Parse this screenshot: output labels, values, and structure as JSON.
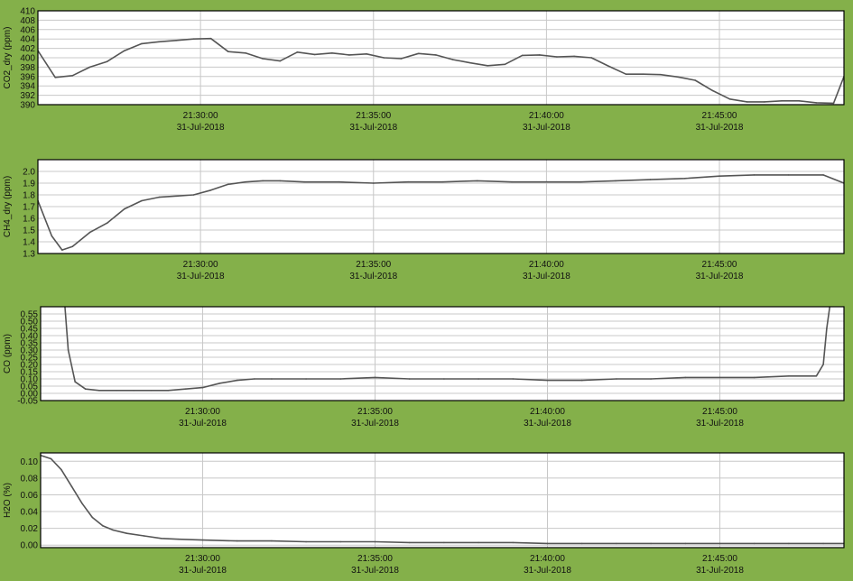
{
  "window": {
    "background": "#84b04a",
    "plot_background": "#ffffff",
    "grid_color": "#c8c8c8",
    "line_color": "#555555"
  },
  "chart_data": [
    {
      "type": "line",
      "ylabel": "CO2_dry (ppm)",
      "ylim": [
        390,
        410
      ],
      "yticks": [
        "410",
        "408",
        "406",
        "404",
        "402",
        "400",
        "398",
        "396",
        "394",
        "392",
        "390"
      ],
      "xlim_minutes": [
        25.3,
        48.6
      ],
      "xticks": [
        {
          "time": "21:30:00",
          "date": "31-Jul-2018",
          "minute": 30
        },
        {
          "time": "21:35:00",
          "date": "31-Jul-2018",
          "minute": 35
        },
        {
          "time": "21:40:00",
          "date": "31-Jul-2018",
          "minute": 40
        },
        {
          "time": "21:45:00",
          "date": "31-Jul-2018",
          "minute": 45
        }
      ],
      "grid": true,
      "series": [
        {
          "x": [
            "21:25:18",
            "21:25:48",
            "21:26:18",
            "21:26:48",
            "21:27:18",
            "21:27:48",
            "21:28:18",
            "21:28:48",
            "21:29:18",
            "21:29:48",
            "21:30:18",
            "21:30:48",
            "21:31:18",
            "21:31:48",
            "21:32:18",
            "21:32:48",
            "21:33:18",
            "21:33:48",
            "21:34:18",
            "21:34:48",
            "21:35:18",
            "21:35:48",
            "21:36:18",
            "21:36:48",
            "21:37:18",
            "21:37:48",
            "21:38:18",
            "21:38:48",
            "21:39:18",
            "21:39:48",
            "21:40:18",
            "21:40:48",
            "21:41:18",
            "21:41:48",
            "21:42:18",
            "21:42:48",
            "21:43:18",
            "21:43:48",
            "21:44:18",
            "21:44:48",
            "21:45:18",
            "21:45:48",
            "21:46:18",
            "21:46:48",
            "21:47:18",
            "21:47:48",
            "21:48:18",
            "21:48:36"
          ],
          "values": [
            401.5,
            395.8,
            396.2,
            398.0,
            399.2,
            401.5,
            403.0,
            403.4,
            403.7,
            404.0,
            404.1,
            401.3,
            401.0,
            399.8,
            399.3,
            401.2,
            400.7,
            401.0,
            400.6,
            400.8,
            400.0,
            399.8,
            400.9,
            400.6,
            399.6,
            398.9,
            398.3,
            398.6,
            400.5,
            400.6,
            400.2,
            400.3,
            400.0,
            398.2,
            396.5,
            396.5,
            396.4,
            395.9,
            395.2,
            393.0,
            391.2,
            390.6,
            390.6,
            390.8,
            390.8,
            390.4,
            390.3,
            396.0
          ]
        }
      ]
    },
    {
      "type": "line",
      "ylabel": "CH4_dry (ppm)",
      "ylim": [
        1.3,
        2.1
      ],
      "yticks": [
        "2.0",
        "1.9",
        "1.8",
        "1.7",
        "1.6",
        "1.5",
        "1.4",
        "1.3"
      ],
      "xlim_minutes": [
        25.3,
        48.6
      ],
      "xticks": [
        {
          "time": "21:30:00",
          "date": "31-Jul-2018",
          "minute": 30
        },
        {
          "time": "21:35:00",
          "date": "31-Jul-2018",
          "minute": 35
        },
        {
          "time": "21:40:00",
          "date": "31-Jul-2018",
          "minute": 40
        },
        {
          "time": "21:45:00",
          "date": "31-Jul-2018",
          "minute": 45
        }
      ],
      "grid": true,
      "series": [
        {
          "x": [
            "21:25:18",
            "21:25:42",
            "21:26:00",
            "21:26:18",
            "21:26:48",
            "21:27:18",
            "21:27:48",
            "21:28:18",
            "21:28:48",
            "21:29:18",
            "21:29:48",
            "21:30:18",
            "21:30:48",
            "21:31:18",
            "21:31:48",
            "21:32:18",
            "21:33:00",
            "21:34:00",
            "21:35:00",
            "21:36:00",
            "21:37:00",
            "21:38:00",
            "21:39:00",
            "21:40:00",
            "21:41:00",
            "21:42:00",
            "21:43:00",
            "21:44:00",
            "21:45:00",
            "21:46:00",
            "21:47:00",
            "21:48:00",
            "21:48:36"
          ],
          "values": [
            1.75,
            1.45,
            1.33,
            1.36,
            1.48,
            1.56,
            1.68,
            1.75,
            1.78,
            1.79,
            1.8,
            1.84,
            1.89,
            1.91,
            1.92,
            1.92,
            1.91,
            1.91,
            1.9,
            1.91,
            1.91,
            1.92,
            1.91,
            1.91,
            1.91,
            1.92,
            1.93,
            1.94,
            1.96,
            1.97,
            1.97,
            1.97,
            1.9
          ]
        }
      ]
    },
    {
      "type": "line",
      "ylabel": "CO (ppm)",
      "ylim": [
        -0.05,
        0.6
      ],
      "yticks": [
        "0.55",
        "0.50",
        "0.45",
        "0.40",
        "0.35",
        "0.30",
        "0.25",
        "0.20",
        "0.15",
        "0.10",
        "0.05",
        "0.00",
        "-0.05"
      ],
      "xlim_minutes": [
        25.3,
        48.6
      ],
      "xticks": [
        {
          "time": "21:30:00",
          "date": "31-Jul-2018",
          "minute": 30
        },
        {
          "time": "21:35:00",
          "date": "31-Jul-2018",
          "minute": 35
        },
        {
          "time": "21:40:00",
          "date": "31-Jul-2018",
          "minute": 40
        },
        {
          "time": "21:45:00",
          "date": "31-Jul-2018",
          "minute": 45
        }
      ],
      "grid": true,
      "series": [
        {
          "x": [
            "21:26:00",
            "21:26:06",
            "21:26:18",
            "21:26:36",
            "21:27:00",
            "21:27:30",
            "21:28:00",
            "21:28:30",
            "21:29:00",
            "21:29:30",
            "21:30:00",
            "21:30:30",
            "21:31:00",
            "21:31:30",
            "21:32:00",
            "21:33:00",
            "21:34:00",
            "21:35:00",
            "21:36:00",
            "21:37:00",
            "21:38:00",
            "21:39:00",
            "21:40:00",
            "21:41:00",
            "21:42:00",
            "21:43:00",
            "21:44:00",
            "21:45:00",
            "21:46:00",
            "21:47:00",
            "21:47:48",
            "21:48:00",
            "21:48:06",
            "21:48:12"
          ],
          "values": [
            0.62,
            0.3,
            0.08,
            0.03,
            0.02,
            0.02,
            0.02,
            0.02,
            0.02,
            0.03,
            0.04,
            0.07,
            0.09,
            0.1,
            0.1,
            0.1,
            0.1,
            0.11,
            0.1,
            0.1,
            0.1,
            0.1,
            0.09,
            0.09,
            0.1,
            0.1,
            0.11,
            0.11,
            0.11,
            0.12,
            0.12,
            0.2,
            0.45,
            0.62
          ]
        }
      ]
    },
    {
      "type": "line",
      "ylabel": "H2O (%)",
      "ylim": [
        -0.003,
        0.11
      ],
      "yticks": [
        "0.10",
        "0.08",
        "0.06",
        "0.04",
        "0.02",
        "0.00"
      ],
      "xlim_minutes": [
        25.3,
        48.6
      ],
      "xticks": [
        {
          "time": "21:30:00",
          "date": "31-Jul-2018",
          "minute": 30
        },
        {
          "time": "21:35:00",
          "date": "31-Jul-2018",
          "minute": 35
        },
        {
          "time": "21:40:00",
          "date": "31-Jul-2018",
          "minute": 40
        },
        {
          "time": "21:45:00",
          "date": "31-Jul-2018",
          "minute": 45
        }
      ],
      "grid": true,
      "series": [
        {
          "x": [
            "21:25:18",
            "21:25:36",
            "21:25:54",
            "21:26:12",
            "21:26:30",
            "21:26:48",
            "21:27:06",
            "21:27:24",
            "21:27:48",
            "21:28:18",
            "21:28:48",
            "21:29:18",
            "21:30:00",
            "21:31:00",
            "21:32:00",
            "21:33:00",
            "21:34:00",
            "21:35:00",
            "21:36:00",
            "21:37:00",
            "21:38:00",
            "21:39:00",
            "21:40:00",
            "21:41:00",
            "21:42:00",
            "21:43:00",
            "21:44:00",
            "21:45:00",
            "21:46:00",
            "21:47:00",
            "21:48:00",
            "21:48:36"
          ],
          "values": [
            0.107,
            0.103,
            0.09,
            0.07,
            0.05,
            0.033,
            0.023,
            0.018,
            0.014,
            0.011,
            0.008,
            0.007,
            0.006,
            0.005,
            0.005,
            0.004,
            0.004,
            0.004,
            0.003,
            0.003,
            0.003,
            0.003,
            0.002,
            0.002,
            0.002,
            0.002,
            0.002,
            0.002,
            0.002,
            0.002,
            0.002,
            0.002
          ]
        }
      ]
    }
  ]
}
